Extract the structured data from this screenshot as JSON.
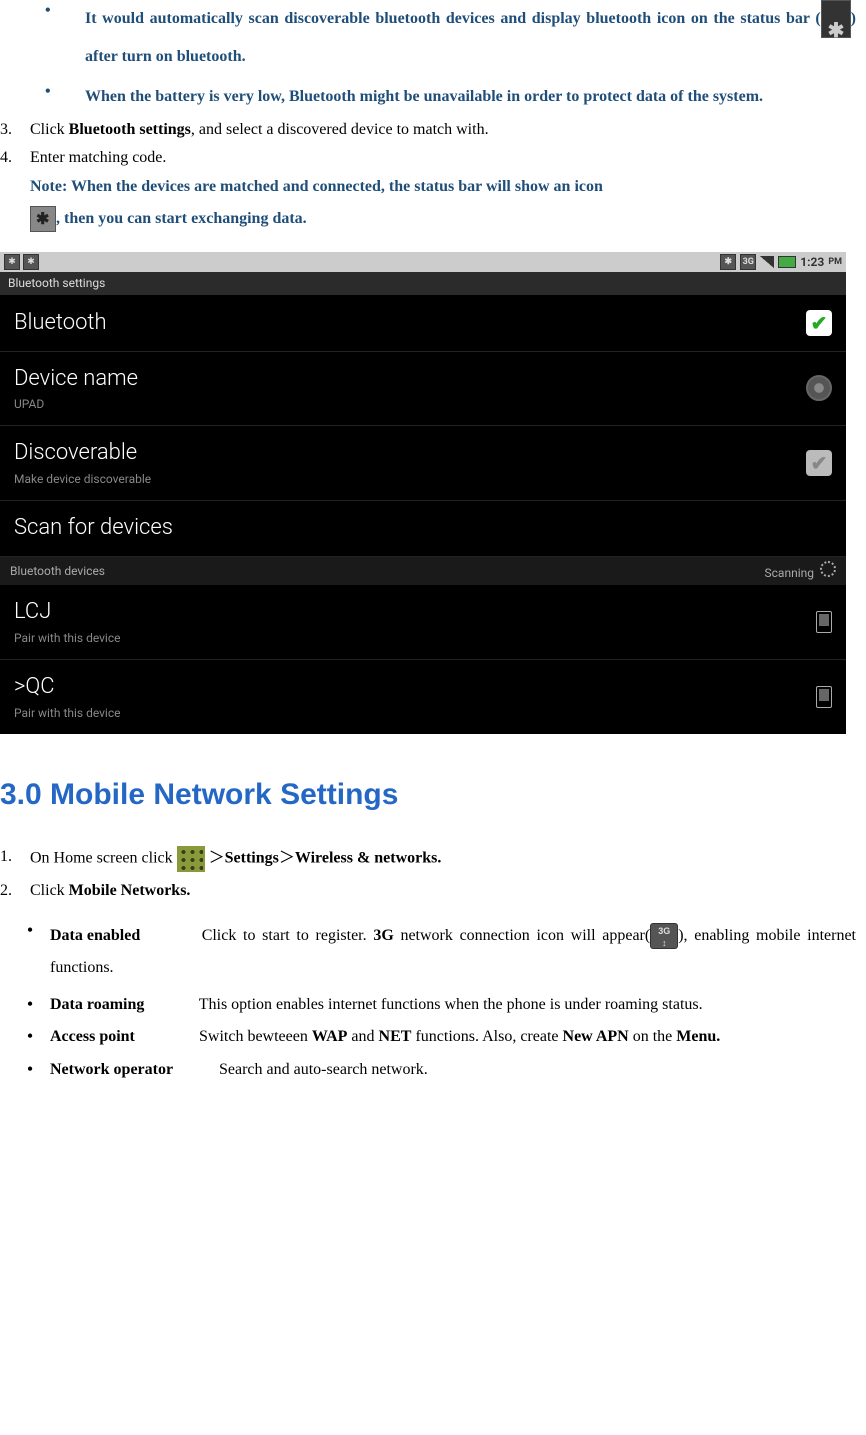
{
  "intro_bullets": [
    {
      "pre": "It would automatically scan discoverable bluetooth devices and display bluetooth icon on the status bar (",
      "post": ") after turn on bluetooth."
    },
    {
      "text": "When the battery is very low, Bluetooth might be unavailable in order to protect data of the system."
    }
  ],
  "steps": {
    "s3_pre": "Click ",
    "s3_bold": "Bluetooth settings",
    "s3_post": ", and select a discovered device to match with.",
    "s4": "Enter matching code."
  },
  "note": {
    "label": "Note:  ",
    "line1": "When the devices are matched and connected, the status bar will show an icon",
    "line2": ", then you can start exchanging data."
  },
  "screenshot": {
    "status_time": "1:23",
    "status_ampm": "PM",
    "title": "Bluetooth settings",
    "rows": {
      "bluetooth": "Bluetooth",
      "devname_t": "Device name",
      "devname_s": "UPAD",
      "disc_t": "Discoverable",
      "disc_s": "Make device discoverable",
      "scan": "Scan for devices"
    },
    "devices_hdr": "Bluetooth devices",
    "devices_scan": "Scanning",
    "devices": [
      {
        "name": "LCJ",
        "sub": "Pair with this device"
      },
      {
        "name": ">QC",
        "sub": "Pair with this device"
      }
    ]
  },
  "section_heading": "3.0 Mobile Network Settings",
  "nav_steps": {
    "s1_pre": "On Home screen click ",
    "s1_post": " ＞",
    "s1_b1": "Settings",
    "s1_mid": "＞",
    "s1_b2": "Wireless & networks.",
    "s2_pre": "Click ",
    "s2_bold": "Mobile Networks."
  },
  "options": [
    {
      "term": "Data enabled",
      "pre": "Click to start to register. ",
      "b1": "3G",
      "mid": " network connection icon will appear(",
      "post": "), enabling mobile internet functions."
    },
    {
      "term": "Data roaming",
      "text": "This option enables internet functions when the phone is under roaming status."
    },
    {
      "term": "Access point",
      "pre": "Switch bewteeen ",
      "b1": "WAP",
      "mid1": " and ",
      "b2": "NET",
      "mid2": " functions. Also, create ",
      "b3": "New APN",
      "mid3": " on the ",
      "b4": "Menu."
    },
    {
      "term": "Network operator",
      "text": "Search and auto-search network."
    }
  ]
}
